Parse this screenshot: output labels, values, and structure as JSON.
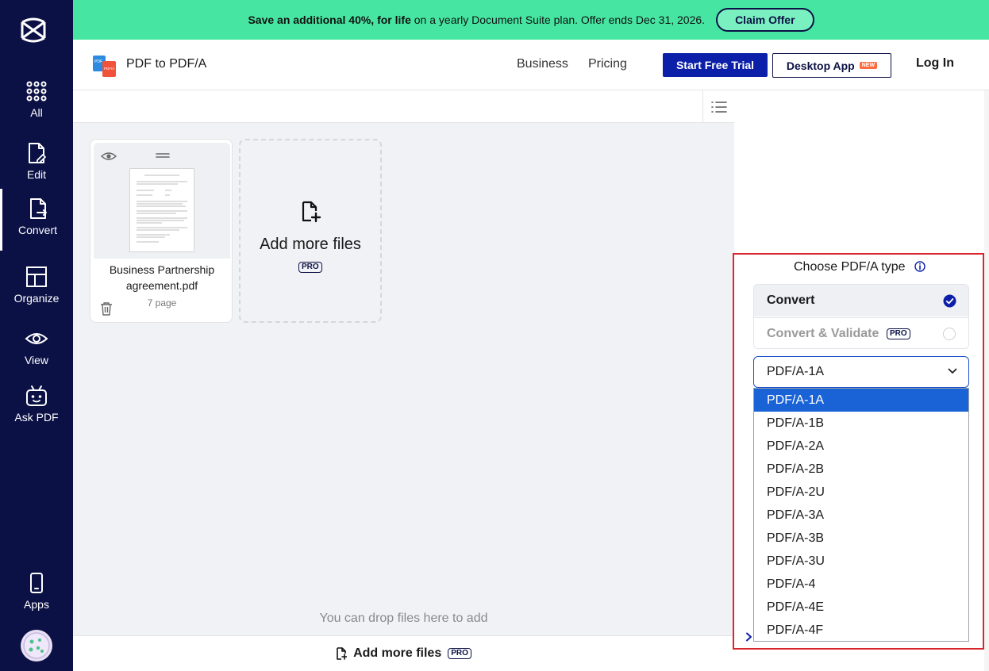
{
  "sidebar": {
    "items": [
      {
        "label": "All",
        "icon": "grid-icon"
      },
      {
        "label": "Edit",
        "icon": "edit-document-icon"
      },
      {
        "label": "Convert",
        "icon": "convert-document-icon"
      },
      {
        "label": "Organize",
        "icon": "layout-icon"
      },
      {
        "label": "View",
        "icon": "eye-icon"
      },
      {
        "label": "Ask PDF",
        "icon": "robot-icon"
      }
    ],
    "apps_label": "Apps",
    "active": "Convert"
  },
  "promo": {
    "strong_text": "Save an additional 40%, for life",
    "text": " on a yearly Document Suite plan. Offer ends Dec 31, 2026.",
    "button_label": "Claim Offer",
    "color": "#46e6a2"
  },
  "header": {
    "title": "PDF to PDF/A",
    "nav": [
      "Business",
      "Pricing"
    ],
    "trial_button": "Start Free Trial",
    "desktop_button": "Desktop App",
    "new_badge": "NEW",
    "login": "Log In"
  },
  "files": [
    {
      "name": "Business Partnership agreement.pdf",
      "pages": "7 page"
    }
  ],
  "add_card": {
    "label": "Add more files",
    "badge": "PRO"
  },
  "drop_hint": "You can drop files here to add",
  "bottom_bar": {
    "label": "Add more files",
    "badge": "PRO"
  },
  "panel": {
    "title": "Choose PDF/A type",
    "options": [
      {
        "label": "Convert",
        "selected": true
      },
      {
        "label": "Convert & Validate",
        "badge": "PRO",
        "selected": false
      }
    ],
    "select": {
      "value": "PDF/A-1A",
      "options": [
        "PDF/A-1A",
        "PDF/A-1B",
        "PDF/A-2A",
        "PDF/A-2B",
        "PDF/A-2U",
        "PDF/A-3A",
        "PDF/A-3B",
        "PDF/A-3U",
        "PDF/A-4",
        "PDF/A-4E",
        "PDF/A-4F"
      ]
    }
  },
  "colors": {
    "sidebar": "#0b1145",
    "accent": "#0b1fa8",
    "highlight": "#d9262e",
    "dropdown_active": "#1a63d6"
  }
}
